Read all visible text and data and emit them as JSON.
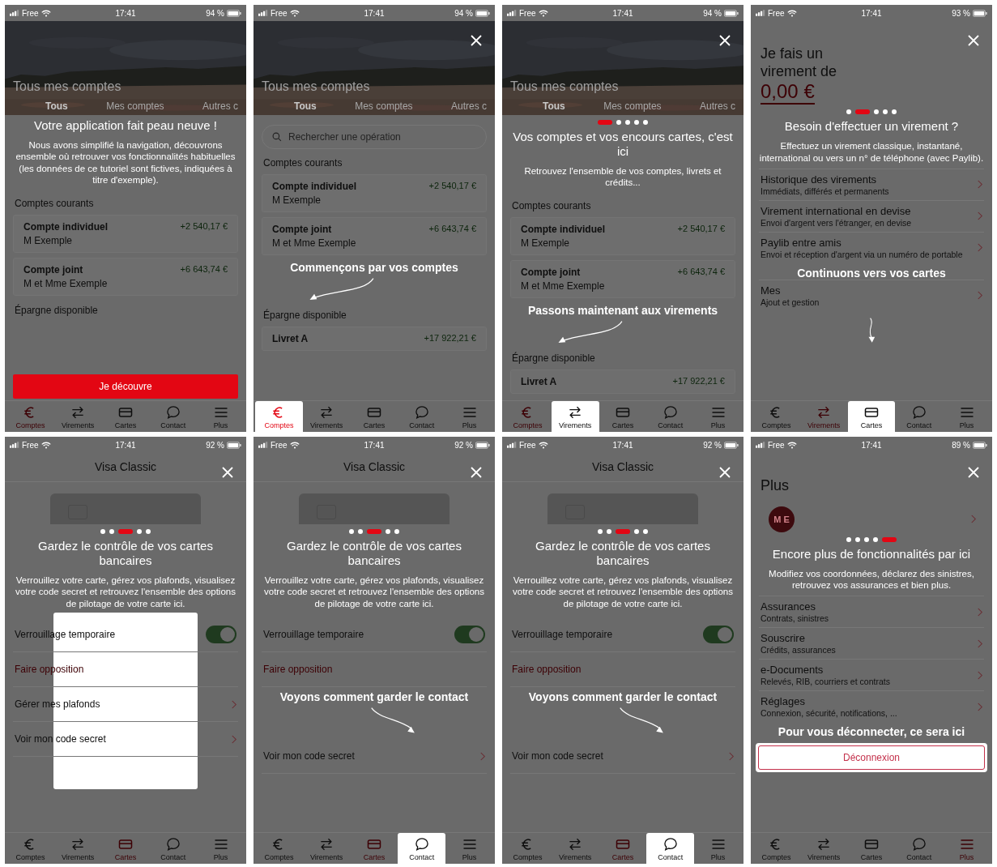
{
  "screens": [
    {
      "status": {
        "carrier": "Free",
        "time": "17:41",
        "battery": "94 %"
      },
      "close": false,
      "blocks": [
        {
          "kind": "hero",
          "title": "Tous mes comptes",
          "tabs": [
            {
              "label": "Tous",
              "selected": true
            },
            {
              "label": "Mes comptes",
              "selected": false
            },
            {
              "label": "Autres c",
              "selected": false
            }
          ]
        },
        {
          "kind": "title",
          "text": "Votre application fait peau neuve !"
        },
        {
          "kind": "body",
          "text": "Nous avons simplifié la navigation, découvrons ensemble où retrouver vos fonctionnalités habituelles (les données de ce tutoriel sont fictives, indiquées à titre d'exemple)."
        },
        {
          "kind": "section",
          "text": "Comptes courants"
        },
        {
          "kind": "account",
          "name": "Compte individuel",
          "owner": "M Exemple",
          "amount": "+2 540,17 €"
        },
        {
          "kind": "account",
          "name": "Compte joint",
          "owner": "M et Mme Exemple",
          "amount": "+6 643,74 €"
        },
        {
          "kind": "section",
          "text": "Épargne disponible"
        },
        {
          "kind": "button",
          "text": "Je découvre"
        }
      ],
      "tabs": [
        {
          "label": "Comptes",
          "selected": true,
          "highlighted": false
        },
        {
          "label": "Virements",
          "selected": false,
          "highlighted": false
        },
        {
          "label": "Cartes",
          "selected": false,
          "highlighted": false
        },
        {
          "label": "Contact",
          "selected": false,
          "highlighted": false
        },
        {
          "label": "Plus",
          "selected": false,
          "highlighted": false
        }
      ]
    },
    {
      "status": {
        "carrier": "Free",
        "time": "17:41",
        "battery": "94 %"
      },
      "close": true,
      "blocks": [
        {
          "kind": "hero",
          "title": "Tous mes comptes",
          "tabs": [
            {
              "label": "Tous",
              "selected": true
            },
            {
              "label": "Mes comptes",
              "selected": false
            },
            {
              "label": "Autres c",
              "selected": false
            }
          ]
        },
        {
          "kind": "search",
          "placeholder": "Rechercher une opération"
        },
        {
          "kind": "section",
          "text": "Comptes courants"
        },
        {
          "kind": "account",
          "name": "Compte individuel",
          "owner": "M Exemple",
          "amount": "+2 540,17 €"
        },
        {
          "kind": "account",
          "name": "Compte joint",
          "owner": "M et Mme Exemple",
          "amount": "+6 643,74 €"
        },
        {
          "kind": "hint",
          "text": "Commençons par vos comptes"
        },
        {
          "kind": "arrow"
        },
        {
          "kind": "section",
          "text": "Épargne disponible"
        },
        {
          "kind": "account",
          "name": "Livret A",
          "amount": "+17 922,21 €"
        }
      ],
      "tabs": [
        {
          "label": "Comptes",
          "selected": true,
          "highlighted": true
        },
        {
          "label": "Virements",
          "selected": false,
          "highlighted": false
        },
        {
          "label": "Cartes",
          "selected": false,
          "highlighted": false
        },
        {
          "label": "Contact",
          "selected": false,
          "highlighted": false
        },
        {
          "label": "Plus",
          "selected": false,
          "highlighted": false
        }
      ]
    },
    {
      "status": {
        "carrier": "Free",
        "time": "17:41",
        "battery": "94 %"
      },
      "close": true,
      "blocks": [
        {
          "kind": "hero",
          "title": "Tous mes comptes",
          "tabs": [
            {
              "label": "Tous",
              "selected": true
            },
            {
              "label": "Mes comptes",
              "selected": false
            },
            {
              "label": "Autres c",
              "selected": false
            }
          ]
        },
        {
          "kind": "dots",
          "dots": [
            {
              "selected": true
            },
            {
              "selected": false
            },
            {
              "selected": false
            },
            {
              "selected": false
            },
            {
              "selected": false
            }
          ]
        },
        {
          "kind": "title",
          "text": "Vos comptes et vos encours cartes, c'est ici"
        },
        {
          "kind": "body",
          "text": "Retrouvez l'ensemble de vos comptes, livrets et crédits..."
        },
        {
          "kind": "section",
          "text": "Comptes courants"
        },
        {
          "kind": "account",
          "name": "Compte individuel",
          "owner": "M Exemple",
          "amount": "+2 540,17 €"
        },
        {
          "kind": "account",
          "name": "Compte joint",
          "owner": "M et Mme Exemple",
          "amount": "+6 643,74 €"
        },
        {
          "kind": "hint",
          "text": "Passons maintenant aux virements"
        },
        {
          "kind": "arrow"
        },
        {
          "kind": "section",
          "text": "Épargne disponible"
        },
        {
          "kind": "account",
          "name": "Livret A",
          "amount": "+17 922,21 €"
        }
      ],
      "tabs": [
        {
          "label": "Comptes",
          "selected": true,
          "highlighted": false
        },
        {
          "label": "Virements",
          "selected": false,
          "highlighted": true
        },
        {
          "label": "Cartes",
          "selected": false,
          "highlighted": false
        },
        {
          "label": "Contact",
          "selected": false,
          "highlighted": false
        },
        {
          "label": "Plus",
          "selected": false,
          "highlighted": false
        }
      ]
    },
    {
      "status": {
        "carrier": "Free",
        "time": "17:41",
        "battery": "93 %"
      },
      "close": true,
      "blocks": [
        {
          "kind": "heading",
          "text": "Je fais un virement de"
        },
        {
          "kind": "amount",
          "text": "0,00 €"
        },
        {
          "kind": "dots",
          "dots": [
            {
              "selected": false
            },
            {
              "selected": true
            },
            {
              "selected": false
            },
            {
              "selected": false
            },
            {
              "selected": false
            }
          ]
        },
        {
          "kind": "title",
          "text": "Besoin d'effectuer un virement ?"
        },
        {
          "kind": "body",
          "text": "Effectuez un virement classique, instantané, international ou vers un n° de téléphone (avec Paylib)."
        },
        {
          "kind": "menu",
          "items": [
            {
              "title": "Historique des virements",
              "subtitle": "Immédiats, différés et permanents"
            },
            {
              "title": "Virement international en devise",
              "subtitle": "Envoi d'argent vers l'étranger, en devise"
            },
            {
              "title": "Paylib entre amis",
              "subtitle": "Envoi et réception d'argent via un numéro de portable"
            }
          ]
        },
        {
          "kind": "hint",
          "text": "Continuons vers vos cartes"
        },
        {
          "kind": "menu",
          "items": [
            {
              "title": "Mes",
              "subtitle": "Ajout et gestion"
            }
          ]
        },
        {
          "kind": "arrow"
        }
      ],
      "tabs": [
        {
          "label": "Comptes",
          "selected": false,
          "highlighted": false
        },
        {
          "label": "Virements",
          "selected": true,
          "highlighted": false
        },
        {
          "label": "Cartes",
          "selected": false,
          "highlighted": true
        },
        {
          "label": "Contact",
          "selected": false,
          "highlighted": false
        },
        {
          "label": "Plus",
          "selected": false,
          "highlighted": false
        }
      ]
    },
    {
      "status": {
        "carrier": "Free",
        "time": "17:41",
        "battery": "92 %"
      },
      "close": true,
      "blocks": [
        {
          "kind": "topbar",
          "text": "Visa Classic"
        },
        {
          "kind": "bankcard"
        },
        {
          "kind": "dots",
          "dots": [
            {
              "selected": false
            },
            {
              "selected": false
            },
            {
              "selected": true
            },
            {
              "selected": false
            },
            {
              "selected": false
            }
          ]
        },
        {
          "kind": "title",
          "text": "Gardez le contrôle de vos cartes bancaires"
        },
        {
          "kind": "body",
          "text": "Verrouillez votre carte, gérez vos plafonds, visualisez votre code secret et retrouvez l'ensemble des options de pilotage de votre carte ici."
        },
        {
          "kind": "settings",
          "spotlight": true,
          "rows": [
            {
              "kind": "toggle",
              "label": "Verrouillage temporaire",
              "on": true
            },
            {
              "kind": "action",
              "label": "Faire opposition"
            },
            {
              "kind": "nav",
              "label": "Gérer mes plafonds"
            },
            {
              "kind": "nav",
              "label": "Voir mon code secret"
            }
          ]
        }
      ],
      "tabs": [
        {
          "label": "Comptes",
          "selected": false,
          "highlighted": false
        },
        {
          "label": "Virements",
          "selected": false,
          "highlighted": false
        },
        {
          "label": "Cartes",
          "selected": true,
          "highlighted": false
        },
        {
          "label": "Contact",
          "selected": false,
          "highlighted": false
        },
        {
          "label": "Plus",
          "selected": false,
          "highlighted": false
        }
      ]
    },
    {
      "status": {
        "carrier": "Free",
        "time": "17:41",
        "battery": "92 %"
      },
      "close": true,
      "blocks": [
        {
          "kind": "topbar",
          "text": "Visa Classic"
        },
        {
          "kind": "bankcard"
        },
        {
          "kind": "dots",
          "dots": [
            {
              "selected": false
            },
            {
              "selected": false
            },
            {
              "selected": true
            },
            {
              "selected": false
            },
            {
              "selected": false
            }
          ]
        },
        {
          "kind": "title",
          "text": "Gardez le contrôle de vos cartes bancaires"
        },
        {
          "kind": "body",
          "text": "Verrouillez votre carte, gérez vos plafonds, visualisez votre code secret et retrouvez l'ensemble des options de pilotage de votre carte ici."
        },
        {
          "kind": "settings",
          "spotlight": false,
          "rows": [
            {
              "kind": "toggle",
              "label": "Verrouillage temporaire",
              "on": true
            },
            {
              "kind": "action",
              "label": "Faire opposition"
            }
          ]
        },
        {
          "kind": "hint",
          "text": "Voyons comment garder le contact"
        },
        {
          "kind": "arrow"
        },
        {
          "kind": "settings",
          "spotlight": false,
          "rows": [
            {
              "kind": "nav",
              "label": "Voir mon code secret"
            }
          ]
        }
      ],
      "tabs": [
        {
          "label": "Comptes",
          "selected": false,
          "highlighted": false
        },
        {
          "label": "Virements",
          "selected": false,
          "highlighted": false
        },
        {
          "label": "Cartes",
          "selected": true,
          "highlighted": false
        },
        {
          "label": "Contact",
          "selected": false,
          "highlighted": true
        },
        {
          "label": "Plus",
          "selected": false,
          "highlighted": false
        }
      ]
    },
    {
      "status": {
        "carrier": "Free",
        "time": "17:41",
        "battery": "92 %"
      },
      "close": true,
      "blocks": [
        {
          "kind": "topbar",
          "text": "Visa Classic"
        },
        {
          "kind": "bankcard"
        },
        {
          "kind": "dots",
          "dots": [
            {
              "selected": false
            },
            {
              "selected": false
            },
            {
              "selected": true
            },
            {
              "selected": false
            },
            {
              "selected": false
            }
          ]
        },
        {
          "kind": "title",
          "text": "Gardez le contrôle de vos cartes bancaires"
        },
        {
          "kind": "body",
          "text": "Verrouillez votre carte, gérez vos plafonds, visualisez votre code secret et retrouvez l'ensemble des options de pilotage de votre carte ici."
        },
        {
          "kind": "settings",
          "spotlight": false,
          "rows": [
            {
              "kind": "toggle",
              "label": "Verrouillage temporaire",
              "on": true
            },
            {
              "kind": "action",
              "label": "Faire opposition"
            }
          ]
        },
        {
          "kind": "hint",
          "text": "Voyons comment garder le contact"
        },
        {
          "kind": "arrow"
        },
        {
          "kind": "settings",
          "spotlight": false,
          "rows": [
            {
              "kind": "nav",
              "label": "Voir mon code secret"
            }
          ]
        }
      ],
      "tabs": [
        {
          "label": "Comptes",
          "selected": false,
          "highlighted": false
        },
        {
          "label": "Virements",
          "selected": false,
          "highlighted": false
        },
        {
          "label": "Cartes",
          "selected": true,
          "highlighted": false
        },
        {
          "label": "Contact",
          "selected": false,
          "highlighted": true
        },
        {
          "label": "Plus",
          "selected": false,
          "highlighted": false
        }
      ]
    },
    {
      "status": {
        "carrier": "Free",
        "time": "17:41",
        "battery": "89 %"
      },
      "close": true,
      "blocks": [
        {
          "kind": "heading",
          "text": "Plus"
        },
        {
          "kind": "profile",
          "initials": "M E"
        },
        {
          "kind": "dots",
          "dots": [
            {
              "selected": false
            },
            {
              "selected": false
            },
            {
              "selected": false
            },
            {
              "selected": false
            },
            {
              "selected": true
            }
          ]
        },
        {
          "kind": "title",
          "text": "Encore plus de fonctionnalités par ici"
        },
        {
          "kind": "body",
          "text": "Modifiez vos coordonnées, déclarez des sinistres, retrouvez vos assurances et bien plus."
        },
        {
          "kind": "menu",
          "items": [
            {
              "title": "Assurances",
              "subtitle": "Contrats, sinistres"
            },
            {
              "title": "Souscrire",
              "subtitle": "Crédits, assurances"
            },
            {
              "title": "e-Documents",
              "subtitle": "Relevés, RIB, courriers et contrats"
            },
            {
              "title": "Réglages",
              "subtitle": "Connexion, sécurité, notifications, ..."
            }
          ]
        },
        {
          "kind": "hint",
          "text": "Pour vous déconnecter, ce sera ici"
        },
        {
          "kind": "logout",
          "text": "Déconnexion"
        }
      ],
      "tabs": [
        {
          "label": "Comptes",
          "selected": false,
          "highlighted": false
        },
        {
          "label": "Virements",
          "selected": false,
          "highlighted": false
        },
        {
          "label": "Cartes",
          "selected": false,
          "highlighted": false
        },
        {
          "label": "Contact",
          "selected": false,
          "highlighted": false
        },
        {
          "label": "Plus",
          "selected": true,
          "highlighted": false
        }
      ]
    }
  ]
}
